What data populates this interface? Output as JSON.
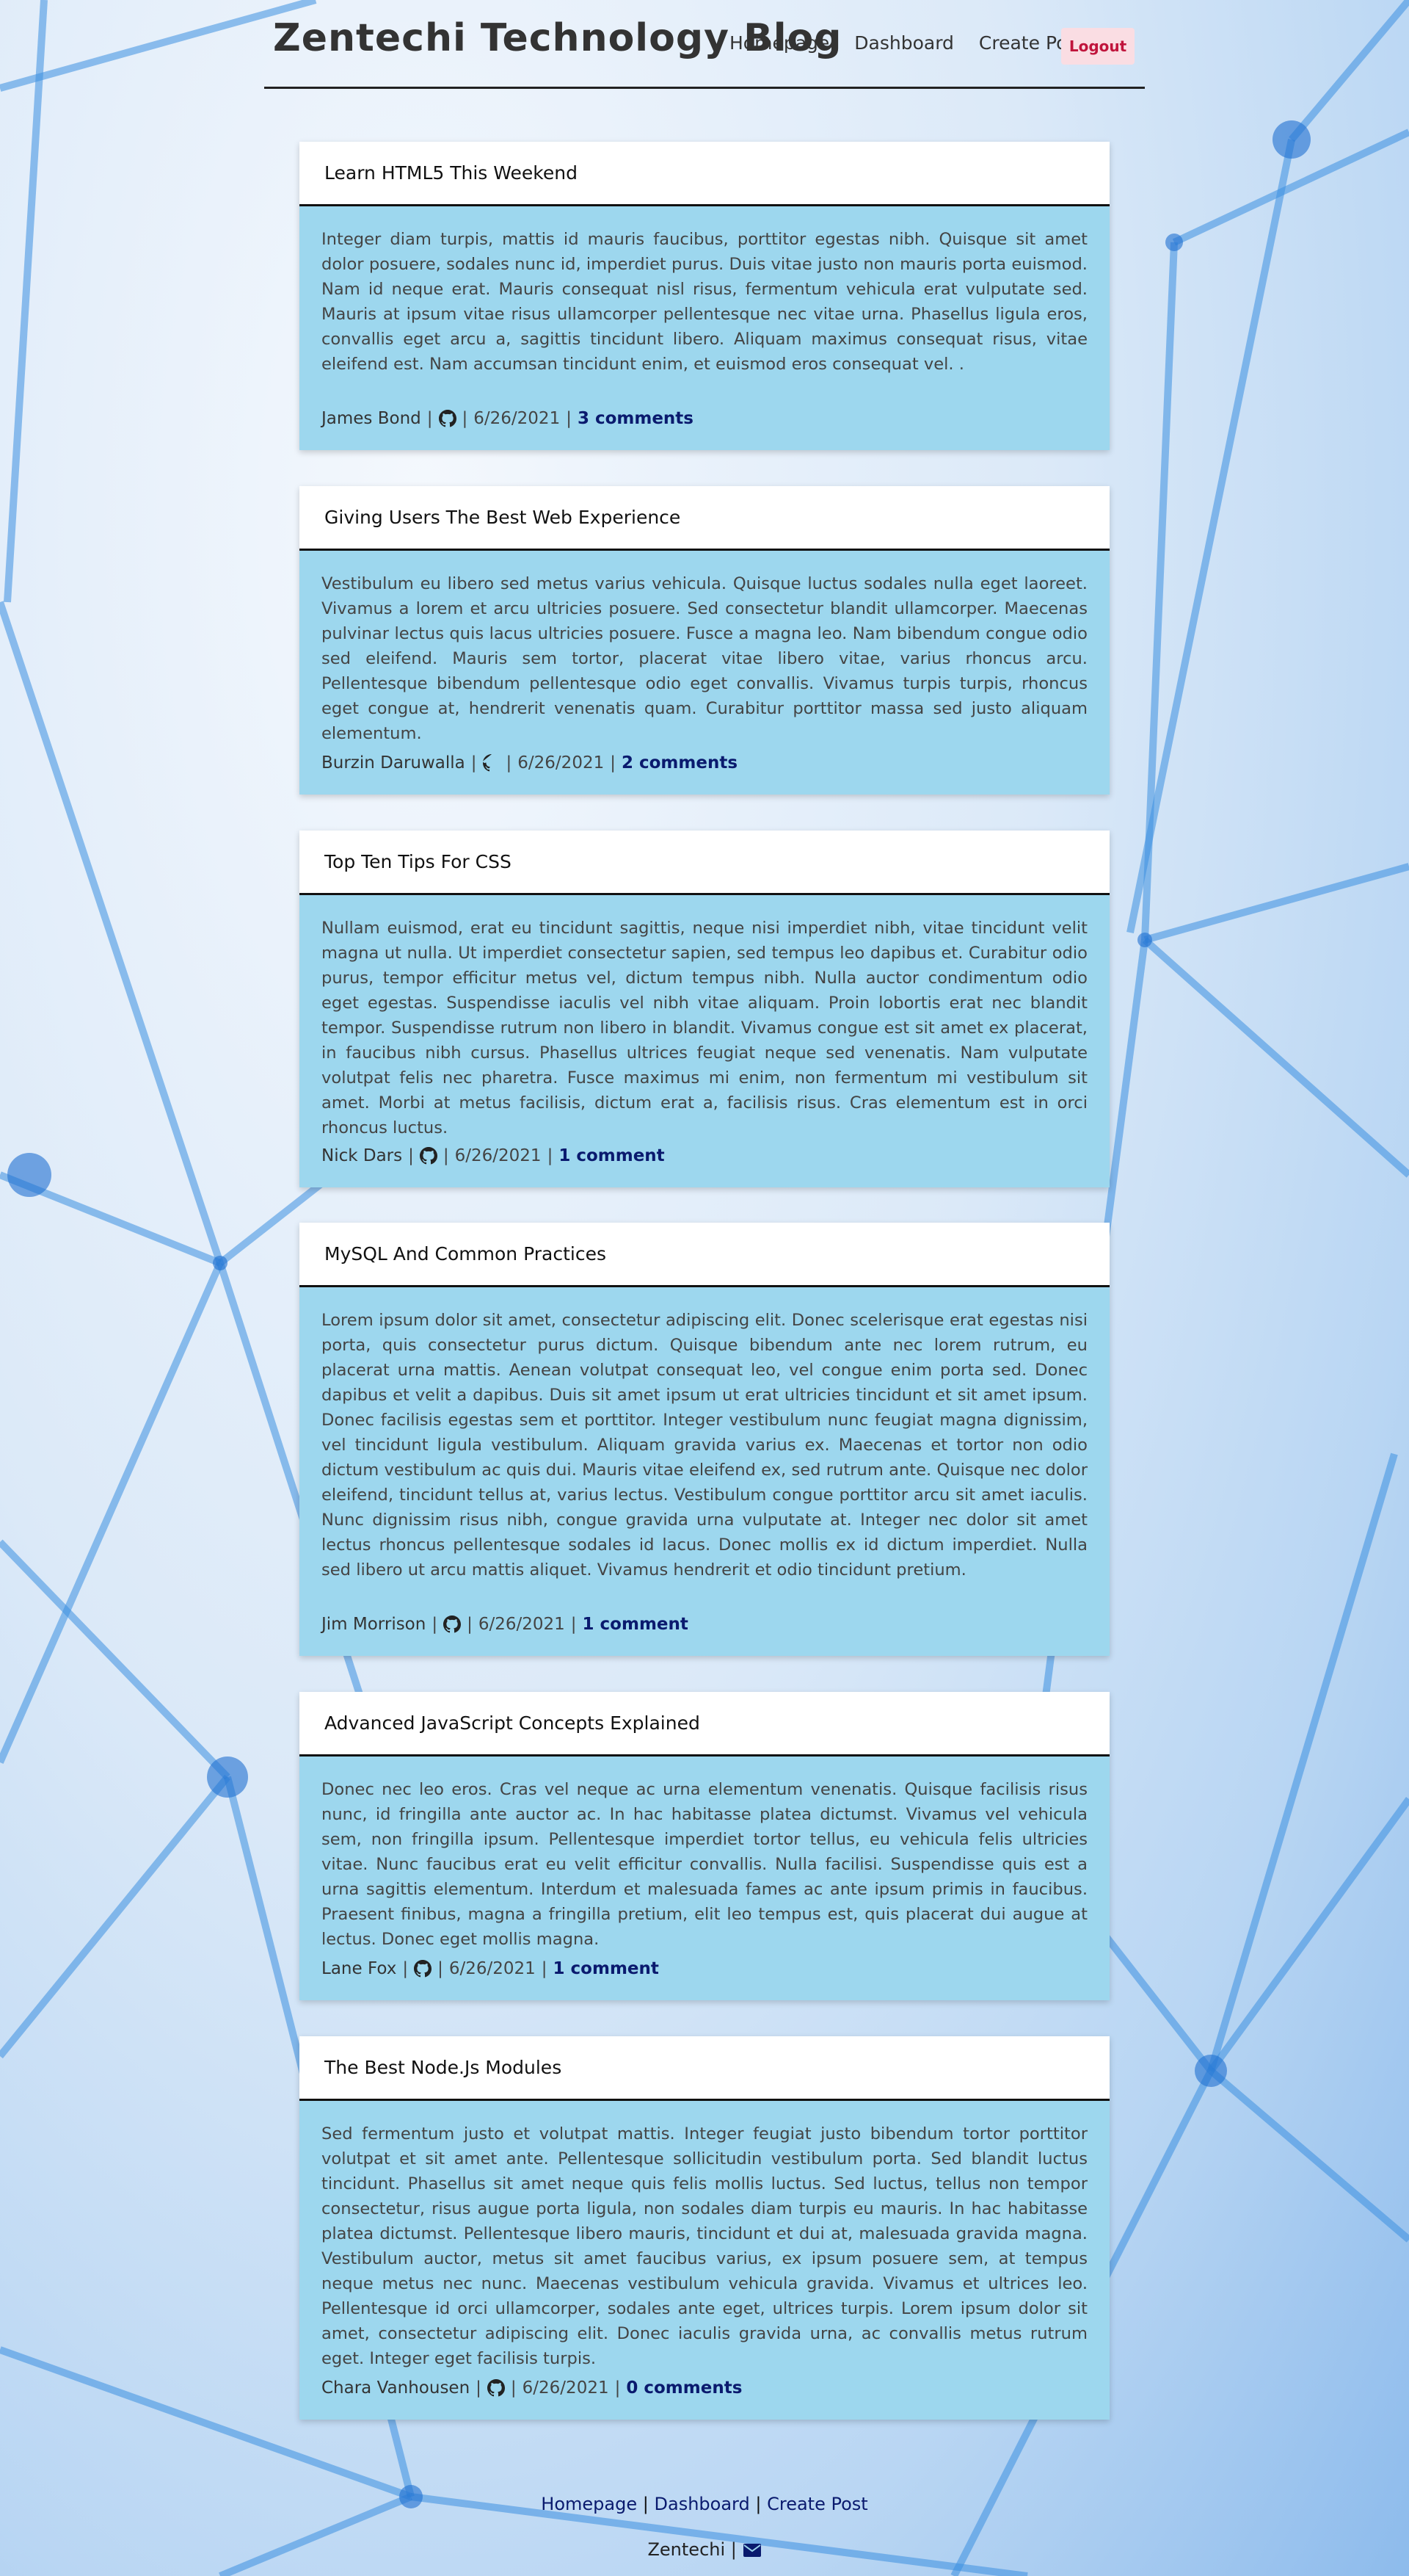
{
  "header": {
    "brand": "Zentechi Technology Blog",
    "nav": [
      "Homepage",
      "Dashboard",
      "Create Post"
    ],
    "logout_label": "Logout"
  },
  "posts": [
    {
      "title": "Learn HTML5 This Weekend",
      "body": "Integer diam turpis, mattis id mauris faucibus, porttitor egestas nibh. Quisque sit amet dolor posuere, sodales nunc id, imperdiet purus. Duis vitae justo non mauris porta euismod. Nam id neque erat. Mauris consequat nisl risus, fermentum vehicula erat vulputate sed. Mauris at ipsum vitae risus ullamcorper pellentesque nec vitae urna. Phasellus ligula eros, convallis eget arcu a, sagittis tincidunt libero. Aliquam maximus consequat risus, vitae eleifend est. Nam accumsan tincidunt enim, et euismod eros consequat vel. .",
      "author": "James Bond",
      "date": "6/26/2021",
      "comments": "3 comments"
    },
    {
      "title": "Giving Users The Best Web Experience",
      "body": "Vestibulum eu libero sed metus varius vehicula. Quisque luctus sodales nulla eget laoreet. Vivamus a lorem et arcu ultricies posuere. Sed consectetur blandit ullamcorper. Maecenas pulvinar lectus quis lacus ultricies posuere. Fusce a magna leo. Nam bibendum congue odio sed eleifend. Mauris sem tortor, placerat vitae libero vitae, varius rhoncus arcu. Pellentesque bibendum pellentesque odio eget convallis. Vivamus turpis turpis, rhoncus eget congue at, hendrerit venenatis quam. Curabitur porttitor massa sed justo aliquam elementum.",
      "author": "Burzin Daruwalla",
      "date": "6/26/2021",
      "comments": "2 comments"
    },
    {
      "title": "Top Ten Tips For CSS",
      "body": "Nullam euismod, erat eu tincidunt sagittis, neque nisi imperdiet nibh, vitae tincidunt velit magna ut nulla. Ut imperdiet consectetur sapien, sed tempus leo dapibus et. Curabitur odio purus, tempor efficitur metus vel, dictum tempus nibh. Nulla auctor condimentum odio eget egestas. Suspendisse iaculis vel nibh vitae aliquam. Proin lobortis erat nec blandit tempor. Suspendisse rutrum non libero in blandit. Vivamus congue est sit amet ex placerat, in faucibus nibh cursus. Phasellus ultrices feugiat neque sed venenatis. Nam vulputate volutpat felis nec pharetra. Fusce maximus mi enim, non fermentum mi vestibulum sit amet. Morbi at metus facilisis, dictum erat a, facilisis risus. Cras elementum est in orci rhoncus luctus.",
      "author": "Nick Dars",
      "date": "6/26/2021",
      "comments": "1 comment"
    },
    {
      "title": "MySQL And Common Practices",
      "body": "Lorem ipsum dolor sit amet, consectetur adipiscing elit. Donec scelerisque erat egestas nisi porta, quis consectetur purus dictum. Quisque bibendum ante nec lorem rutrum, eu placerat urna mattis. Aenean volutpat consequat leo, vel congue enim porta sed. Donec dapibus et velit a dapibus. Duis sit amet ipsum ut erat ultricies tincidunt et sit amet ipsum. Donec facilisis egestas sem et porttitor. Integer vestibulum nunc feugiat magna dignissim, vel tincidunt ligula vestibulum. Aliquam gravida varius ex. Maecenas et tortor non odio dictum vestibulum ac quis dui. Mauris vitae eleifend ex, sed rutrum ante. Quisque nec dolor eleifend, tincidunt tellus at, varius lectus. Vestibulum congue porttitor arcu sit amet iaculis. Nunc dignissim risus nibh, congue gravida urna vulputate at. Integer nec dolor sit amet lectus rhoncus pellentesque sodales id lacus. Donec mollis ex id dictum imperdiet. Nulla sed libero ut arcu mattis aliquet. Vivamus hendrerit et odio tincidunt pretium.",
      "author": "Jim Morrison",
      "date": "6/26/2021",
      "comments": "1 comment"
    },
    {
      "title": "Advanced JavaScript Concepts Explained",
      "body": "Donec nec leo eros. Cras vel neque ac urna elementum venenatis. Quisque facilisis risus nunc, id fringilla ante auctor ac. In hac habitasse platea dictumst. Vivamus vel vehicula sem, non fringilla ipsum. Pellentesque imperdiet tortor tellus, eu vehicula felis ultricies vitae. Nunc faucibus erat eu velit efficitur convallis. Nulla facilisi. Suspendisse quis est a urna sagittis elementum. Interdum et malesuada fames ac ante ipsum primis in faucibus. Praesent finibus, magna a fringilla pretium, elit leo tempus est, quis placerat dui augue at lectus. Donec eget mollis magna.",
      "author": "Lane Fox",
      "date": "6/26/2021",
      "comments": "1 comment"
    },
    {
      "title": "The Best Node.Js Modules",
      "body": "Sed fermentum justo et volutpat mattis. Integer feugiat justo bibendum tortor porttitor volutpat et sit amet ante. Pellentesque sollicitudin vestibulum porta. Sed blandit luctus tincidunt. Phasellus sit amet neque quis felis mollis luctus. Sed luctus, tellus non tempor consectetur, risus augue porta ligula, non sodales diam turpis eu mauris. In hac habitasse platea dictumst. Pellentesque libero mauris, tincidunt et dui at, malesuada gravida magna. Vestibulum auctor, metus sit amet faucibus varius, ex ipsum posuere sem, at tempus neque metus nec nunc. Maecenas vestibulum vehicula gravida. Vivamus et ultrices leo. Pellentesque id orci ullamcorper, sodales ante eget, ultrices turpis. Lorem ipsum dolor sit amet, consectetur adipiscing elit. Donec iaculis gravida urna, ac convallis metus rutrum eget. Integer eget facilisis turpis.",
      "author": "Chara Vanhousen",
      "date": "6/26/2021",
      "comments": "0 comments"
    }
  ],
  "footer": {
    "links": [
      "Homepage",
      "Dashboard",
      "Create Post"
    ],
    "separator": "|",
    "brand": "Zentechi"
  },
  "icons": {
    "github": "github-icon",
    "mail": "envelope-icon"
  },
  "colors": {
    "card": "#9dd7ee",
    "comments_link": "#0a1a6e",
    "logout_bg": "#fadde3",
    "logout_text": "#c0143c"
  }
}
